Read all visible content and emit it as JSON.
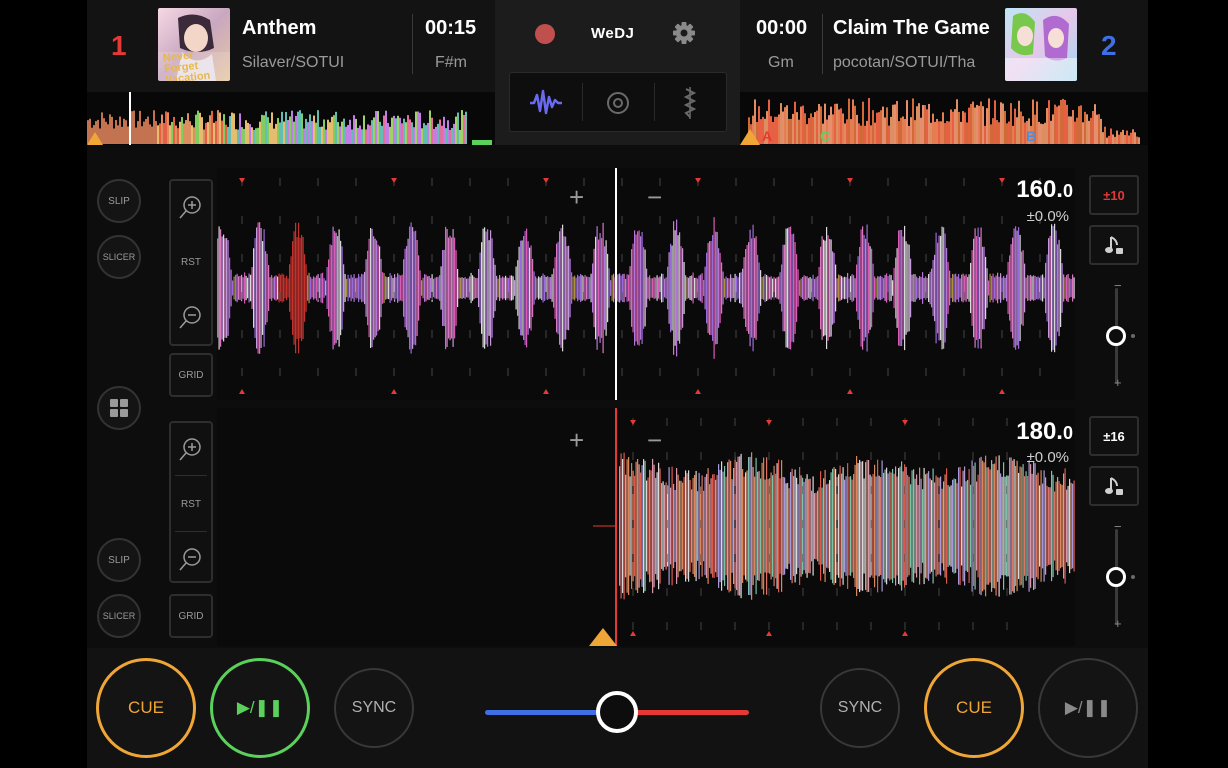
{
  "app": {
    "brand": "WeDJ"
  },
  "deck1": {
    "number": "1",
    "title": "Anthem",
    "artist": "Silaver/SOTUI",
    "time": "00:15",
    "key": "F#m",
    "bpm_int": "160.",
    "bpm_dec": "0",
    "pitch": "±0.0%",
    "range": "±10",
    "cover_text": "Never Forget Vacation",
    "side": {
      "slip": "SLIP",
      "slicer": "SLICER"
    },
    "zoom": {
      "rst": "RST",
      "grid": "GRID"
    }
  },
  "deck2": {
    "number": "2",
    "title": "Claim The Game",
    "artist": "pocotan/SOTUI/Tha",
    "time": "00:00",
    "key": "Gm",
    "bpm_int": "180.",
    "bpm_dec": "0",
    "pitch": "±0.0%",
    "range": "±16",
    "side": {
      "slip": "SLIP",
      "slicer": "SLICER"
    },
    "zoom": {
      "rst": "RST",
      "grid": "GRID"
    },
    "cue_markers": [
      "A",
      "C",
      "B"
    ]
  },
  "waveform": {
    "plus": "+",
    "minus": "−"
  },
  "tempo": {
    "minus": "−",
    "plus": "+"
  },
  "transport": {
    "cue_left": "CUE",
    "play_left": "▶/❚❚",
    "sync_left": "SYNC",
    "sync_right": "SYNC",
    "cue_right": "CUE",
    "play_right": "▶/❚❚"
  },
  "crossfader": {
    "position": 0.5
  },
  "colors": {
    "deck1": "#e53935",
    "deck2": "#3f6fe5",
    "cue": "#f0a637",
    "play_active": "#5bd15b",
    "playhead": "#e53935"
  },
  "icons": [
    "record-icon",
    "gear-icon",
    "waveform-icon",
    "turntable-icon",
    "eq-icon",
    "zoom-in-icon",
    "zoom-out-icon",
    "pads-icon",
    "sync-icon",
    "music-note-lock-icon"
  ]
}
